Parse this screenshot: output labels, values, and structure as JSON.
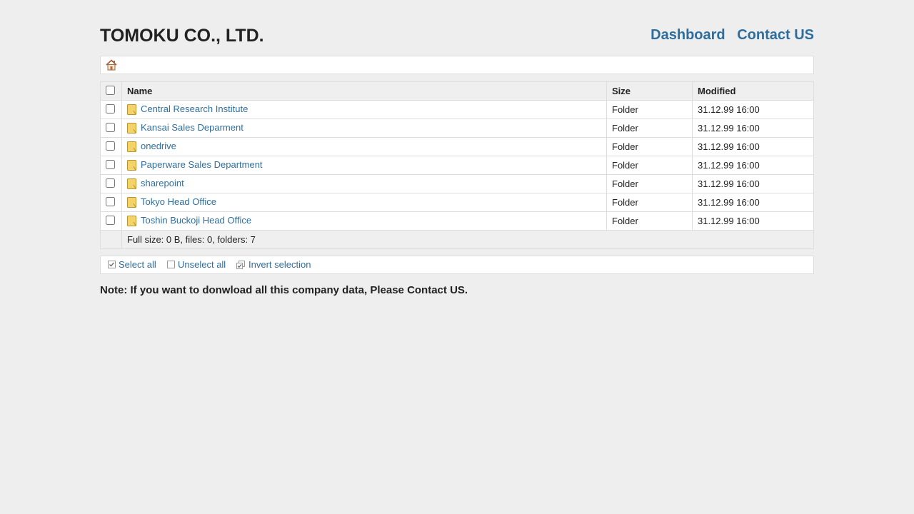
{
  "header": {
    "title": "TOMOKU CO., LTD.",
    "nav": {
      "dashboard": "Dashboard",
      "contact": "Contact US"
    }
  },
  "breadcrumb": {
    "home_icon": "home-icon"
  },
  "table": {
    "columns": {
      "name": "Name",
      "size": "Size",
      "modified": "Modified"
    },
    "rows": [
      {
        "name": "Central Research Institute",
        "size": "Folder",
        "modified": "31.12.99 16:00"
      },
      {
        "name": "Kansai Sales Deparment",
        "size": "Folder",
        "modified": "31.12.99 16:00"
      },
      {
        "name": "onedrive",
        "size": "Folder",
        "modified": "31.12.99 16:00"
      },
      {
        "name": "Paperware Sales Department",
        "size": "Folder",
        "modified": "31.12.99 16:00"
      },
      {
        "name": "sharepoint",
        "size": "Folder",
        "modified": "31.12.99 16:00"
      },
      {
        "name": "Tokyo Head Office",
        "size": "Folder",
        "modified": "31.12.99 16:00"
      },
      {
        "name": "Toshin Buckoji Head Office",
        "size": "Folder",
        "modified": "31.12.99 16:00"
      }
    ],
    "footer": "Full size: 0 B, files: 0, folders: 7"
  },
  "actions": {
    "select_all": "Select all",
    "unselect_all": "Unselect all",
    "invert_selection": "Invert selection"
  },
  "note": "Note: If you want to donwload all this company data, Please Contact US.",
  "colors": {
    "link": "#2e6e9e",
    "background": "#eeeeee",
    "header_row": "#efefef",
    "folder": "#f5d36b"
  }
}
